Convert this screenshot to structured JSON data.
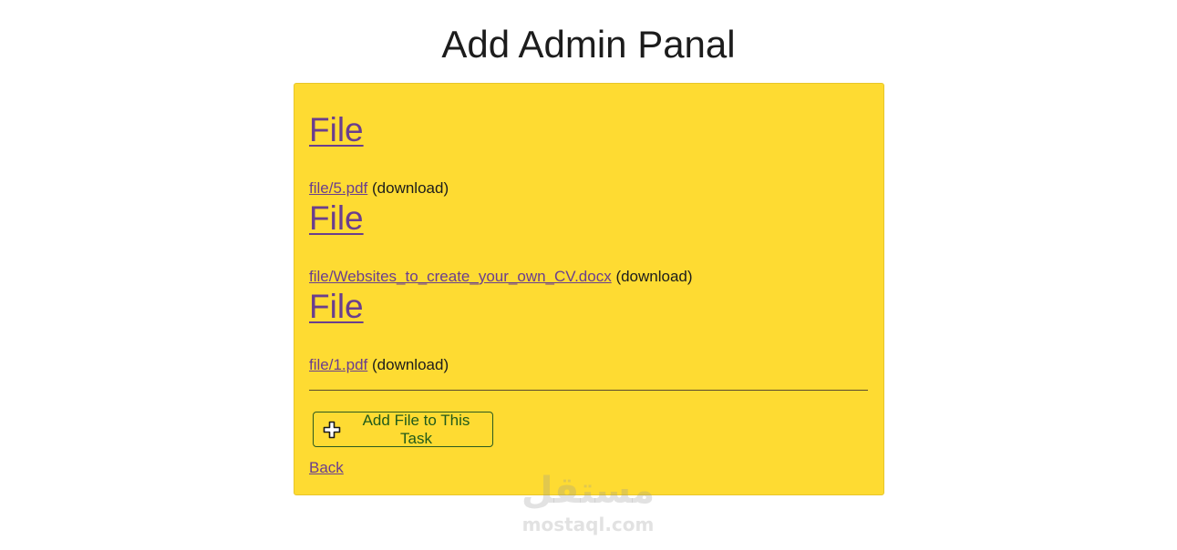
{
  "page": {
    "title": "Add Admin Panal"
  },
  "files": [
    {
      "heading": "File",
      "link_text": "file/5.pdf",
      "suffix": "(download)"
    },
    {
      "heading": "File",
      "link_text": "file/Websites_to_create_your_own_CV.docx",
      "suffix": "(download)"
    },
    {
      "heading": "File",
      "link_text": "file/1.pdf",
      "suffix": "(download)"
    }
  ],
  "actions": {
    "add_file_label": "Add File to This Task",
    "add_file_icon": "plus-icon",
    "back_label": "Back"
  },
  "watermark": {
    "arabic": "مستقل",
    "latin": "mostaql.com"
  },
  "colors": {
    "panel_background": "#fedb32",
    "link": "#6a3e8e",
    "button_text": "#1f5a1a"
  }
}
